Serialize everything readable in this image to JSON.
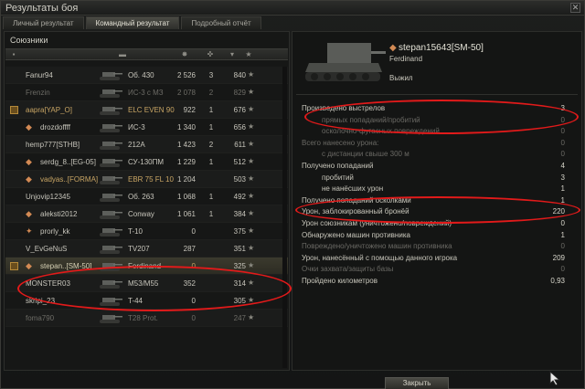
{
  "window": {
    "title": "Результаты боя"
  },
  "tabs": [
    {
      "label": "Личный результат",
      "active": false
    },
    {
      "label": "Командный результат",
      "active": true
    },
    {
      "label": "Подробный отчёт",
      "active": false
    }
  ],
  "left": {
    "header": "Союзники",
    "columns": [
      "tank-icon",
      "damage-icon",
      "frags-icon",
      "xp-icon"
    ],
    "rows": [
      {
        "name": "Fanur94",
        "tank": "Об. 430",
        "damage": "2 526",
        "frags": "3",
        "xp": "840",
        "state": "normal",
        "icon": ""
      },
      {
        "name": "Frenzin",
        "tank": "ИС-3 с МЗ",
        "damage": "2 078",
        "frags": "2",
        "xp": "829",
        "state": "dead",
        "icon": ""
      },
      {
        "name": "aapra[YAP_O]",
        "tank": "ELC EVEN 90",
        "damage": "922",
        "frags": "1",
        "xp": "676",
        "state": "gold",
        "icon": "squad"
      },
      {
        "name": "drozdoffff",
        "tank": "ИС-3",
        "damage": "1 340",
        "frags": "1",
        "xp": "656",
        "state": "normal",
        "icon": "platoon"
      },
      {
        "name": "hemp777[STHB]",
        "tank": "212A",
        "damage": "1 423",
        "frags": "2",
        "xp": "611",
        "state": "normal",
        "icon": ""
      },
      {
        "name": "serdg_8..[EG-05]",
        "tank": "СУ-130ПМ",
        "damage": "1 229",
        "frags": "1",
        "xp": "512",
        "state": "normal",
        "icon": "platoon"
      },
      {
        "name": "vadyas..[FORMA]",
        "tank": "EBR 75 FL 10",
        "damage": "1 204",
        "frags": "",
        "xp": "503",
        "state": "gold",
        "icon": "platoon"
      },
      {
        "name": "Unjovip12345",
        "tank": "Об. 263",
        "damage": "1 068",
        "frags": "1",
        "xp": "492",
        "state": "normal",
        "icon": ""
      },
      {
        "name": "aleksti2012",
        "tank": "Conway",
        "damage": "1 061",
        "frags": "1",
        "xp": "384",
        "state": "normal",
        "icon": "platoon"
      },
      {
        "name": "prorly_kk",
        "tank": "T-10",
        "damage": "0",
        "frags": "",
        "xp": "375",
        "state": "normal",
        "icon": "star"
      },
      {
        "name": "V_EvGeNuS",
        "tank": "TV207",
        "damage": "287",
        "frags": "",
        "xp": "351",
        "state": "normal",
        "icon": ""
      },
      {
        "name": "stepan..[SM-50]",
        "tank": "Ferdinand",
        "damage": "0",
        "frags": "",
        "xp": "325",
        "state": "sel",
        "icon": "platoon"
      },
      {
        "name": "MONSTER03",
        "tank": "M53/M55",
        "damage": "352",
        "frags": "",
        "xp": "314",
        "state": "normal",
        "icon": ""
      },
      {
        "name": "skripi_23",
        "tank": "T-44",
        "damage": "0",
        "frags": "",
        "xp": "305",
        "state": "normal",
        "icon": ""
      },
      {
        "name": "foma790",
        "tank": "T28 Prot.",
        "damage": "0",
        "frags": "",
        "xp": "247",
        "state": "dead",
        "icon": ""
      }
    ]
  },
  "right": {
    "player_name": "stepan15643[SM-50]",
    "tank": "Ferdinand",
    "status": "Выжил",
    "stats": [
      {
        "label": "Произведено выстрелов",
        "value": "3",
        "indent": false,
        "dim": false
      },
      {
        "label": "прямых попаданий/пробитий",
        "value": "0",
        "indent": true,
        "dim": true
      },
      {
        "label": "осколочно-фугасных повреждений",
        "value": "0",
        "indent": true,
        "dim": true
      },
      {
        "label": "Всего нанесено урона:",
        "value": "0",
        "indent": false,
        "dim": true
      },
      {
        "label": "с дистанции свыше 300 м",
        "value": "0",
        "indent": true,
        "dim": true
      },
      {
        "label": "Получено попаданий",
        "value": "4",
        "indent": false,
        "dim": false
      },
      {
        "label": "пробитий",
        "value": "3",
        "indent": true,
        "dim": false
      },
      {
        "label": "не нанёсших урон",
        "value": "1",
        "indent": true,
        "dim": false
      },
      {
        "label": "Получено попаданий осколками",
        "value": "1",
        "indent": false,
        "dim": false
      },
      {
        "label": "Урон, заблокированный бронёй",
        "value": "220",
        "indent": false,
        "dim": false
      },
      {
        "label": "Урон союзникам (уничтожено/повреждений)",
        "value": "0",
        "indent": false,
        "dim": false
      },
      {
        "label": "Обнаружено машин противника",
        "value": "1",
        "indent": false,
        "dim": false
      },
      {
        "label": "Повреждено/уничтожено машин противника",
        "value": "0",
        "indent": false,
        "dim": true
      },
      {
        "label": "Урон, нанесённый с помощью данного игрока",
        "value": "209",
        "indent": false,
        "dim": false
      },
      {
        "label": "Очки захвата/защиты базы",
        "value": "0",
        "indent": false,
        "dim": true
      },
      {
        "label": "Пройдено километров",
        "value": "0,93",
        "indent": false,
        "dim": false
      }
    ]
  },
  "footer": {
    "close_label": "Закрыть"
  },
  "colors": {
    "annotation": "#e21a1a",
    "gold": "#c8a564",
    "text": "#c9c7bc"
  }
}
